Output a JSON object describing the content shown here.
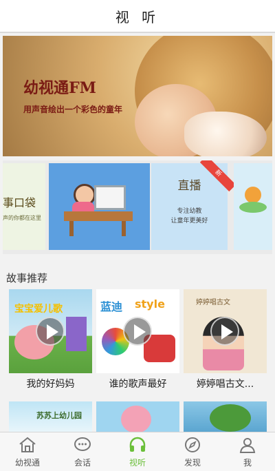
{
  "header": {
    "title": "视 听"
  },
  "banner": {
    "title": "幼视通FM",
    "subtitle": "用声音绘出一个彩色的童年"
  },
  "carousel": {
    "card1": {
      "title": "事口袋",
      "subtitle": "声的你都在这里"
    },
    "card3": {
      "title": "直播",
      "line1": "专注幼教",
      "line2": "让童年更美好",
      "badge": "新"
    }
  },
  "section": {
    "title": "故事推荐"
  },
  "stories": [
    {
      "caption": "我的好妈妈",
      "art_text": "宝宝爱儿歌"
    },
    {
      "caption": "谁的歌声最好",
      "art_text": "蓝迪",
      "art_text2": "style"
    },
    {
      "caption": "婷婷唱古文...",
      "art_text": "婷婷唱古文"
    }
  ],
  "stories_row2": [
    {
      "art_text": "苏苏上幼儿园"
    },
    {
      "art_text": ""
    },
    {
      "art_text": ""
    }
  ],
  "tabs": [
    {
      "label": "幼视通",
      "icon": "home-icon",
      "active": false
    },
    {
      "label": "会话",
      "icon": "chat-icon",
      "active": false
    },
    {
      "label": "视听",
      "icon": "headphones-icon",
      "active": true
    },
    {
      "label": "发现",
      "icon": "compass-icon",
      "active": false
    },
    {
      "label": "我",
      "icon": "user-icon",
      "active": false
    }
  ],
  "colors": {
    "accent": "#6bbf3a",
    "banner_text": "#7a1b14",
    "badge": "#e8453c"
  }
}
